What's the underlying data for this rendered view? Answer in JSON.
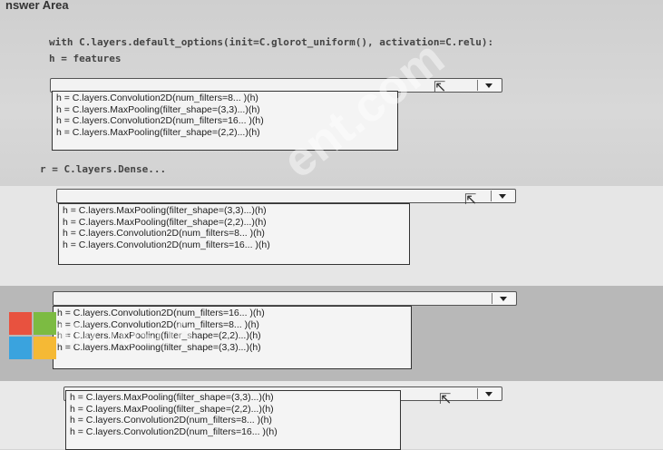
{
  "header": "nswer Area",
  "code": {
    "line1": "with C.layers.default_options(init=C.glorot_uniform(), activation=C.relu):",
    "line2": "h = features",
    "line3": "r = C.layers.Dense..."
  },
  "dropdowns": [
    {
      "options": [
        "h = C.layers.Convolution2D(num_filters=8... )(h)",
        "h = C.layers.MaxPooling(filter_shape=(3,3)...)(h)",
        "h = C.layers.Convolution2D(num_filters=16... )(h)",
        "h = C.layers.MaxPooling(filter_shape=(2,2)...)(h)"
      ]
    },
    {
      "options": [
        "h = C.layers.MaxPooling(filter_shape=(3,3)...)(h)",
        "h = C.layers.MaxPooling(filter_shape=(2,2)...)(h)",
        "h = C.layers.Convolution2D(num_filters=8... )(h)",
        "h = C.layers.Convolution2D(num_filters=16... )(h)"
      ]
    },
    {
      "options": [
        "h = C.layers.Convolution2D(num_filters=16... )(h)",
        "h = C.layers.Convolution2D(num_filters=8... )(h)",
        "h = C.layers.MaxPooling(filter_shape=(2,2)...)(h)",
        "h = C.layers.MaxPooling(filter_shape=(3,3)...)(h)"
      ]
    },
    {
      "options": [
        "h = C.layers.MaxPooling(filter_shape=(3,3)...)(h)",
        "h = C.layers.MaxPooling(filter_shape=(2,2)...)(h)",
        "h = C.layers.Convolution2D(num_filters=8... )(h)",
        "h = C.layers.Convolution2D(num_filters=16... )(h)"
      ]
    }
  ],
  "watermark": "Microsoft",
  "watermark2": "ent.com",
  "icons": {
    "dropdown": "chevron-down-icon",
    "cursor": "mouse-pointer-icon",
    "logo": "microsoft-logo-icon"
  },
  "colors": {
    "logo_red": "#e8523f",
    "logo_green": "#7cbb42",
    "logo_blue": "#3aa3de",
    "logo_yellow": "#f5b935"
  }
}
